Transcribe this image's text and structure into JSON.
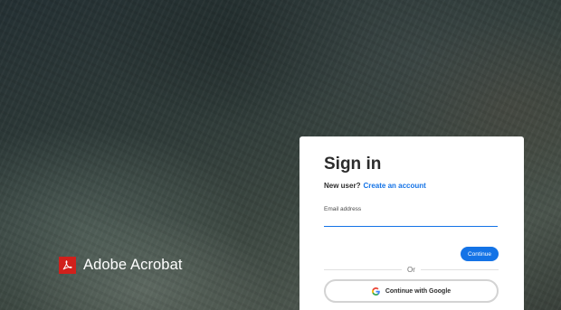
{
  "brand": {
    "name": "Adobe Acrobat",
    "logo_color": "#d1201b"
  },
  "signin": {
    "title": "Sign in",
    "new_user_label": "New user?",
    "create_account_link": "Create an account",
    "email_label": "Email address",
    "email_value": "",
    "continue_label": "Continue",
    "divider_text": "Or",
    "google_label": "Continue with Google",
    "google_icon": "google-icon"
  },
  "colors": {
    "accent": "#1473e6",
    "card_bg": "#ffffff"
  }
}
